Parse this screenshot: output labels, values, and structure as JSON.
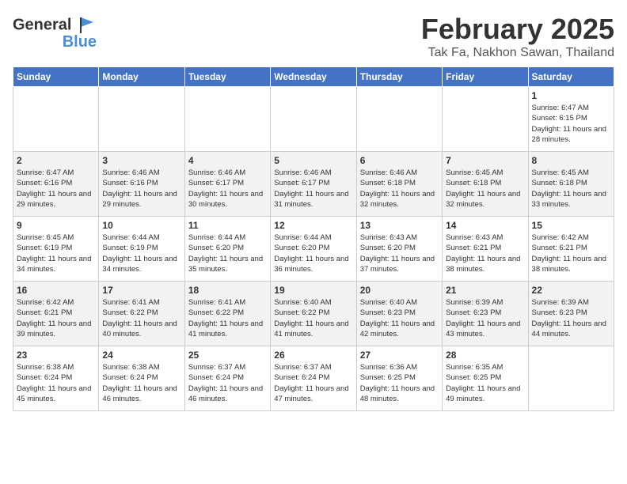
{
  "header": {
    "logo_general": "General",
    "logo_blue": "Blue",
    "month_year": "February 2025",
    "location": "Tak Fa, Nakhon Sawan, Thailand"
  },
  "days_of_week": [
    "Sunday",
    "Monday",
    "Tuesday",
    "Wednesday",
    "Thursday",
    "Friday",
    "Saturday"
  ],
  "weeks": [
    [
      {
        "day": "",
        "sunrise": "",
        "sunset": "",
        "daylight": ""
      },
      {
        "day": "",
        "sunrise": "",
        "sunset": "",
        "daylight": ""
      },
      {
        "day": "",
        "sunrise": "",
        "sunset": "",
        "daylight": ""
      },
      {
        "day": "",
        "sunrise": "",
        "sunset": "",
        "daylight": ""
      },
      {
        "day": "",
        "sunrise": "",
        "sunset": "",
        "daylight": ""
      },
      {
        "day": "",
        "sunrise": "",
        "sunset": "",
        "daylight": ""
      },
      {
        "day": "1",
        "sunrise": "Sunrise: 6:47 AM",
        "sunset": "Sunset: 6:15 PM",
        "daylight": "Daylight: 11 hours and 28 minutes."
      }
    ],
    [
      {
        "day": "2",
        "sunrise": "Sunrise: 6:47 AM",
        "sunset": "Sunset: 6:16 PM",
        "daylight": "Daylight: 11 hours and 29 minutes."
      },
      {
        "day": "3",
        "sunrise": "Sunrise: 6:46 AM",
        "sunset": "Sunset: 6:16 PM",
        "daylight": "Daylight: 11 hours and 29 minutes."
      },
      {
        "day": "4",
        "sunrise": "Sunrise: 6:46 AM",
        "sunset": "Sunset: 6:17 PM",
        "daylight": "Daylight: 11 hours and 30 minutes."
      },
      {
        "day": "5",
        "sunrise": "Sunrise: 6:46 AM",
        "sunset": "Sunset: 6:17 PM",
        "daylight": "Daylight: 11 hours and 31 minutes."
      },
      {
        "day": "6",
        "sunrise": "Sunrise: 6:46 AM",
        "sunset": "Sunset: 6:18 PM",
        "daylight": "Daylight: 11 hours and 32 minutes."
      },
      {
        "day": "7",
        "sunrise": "Sunrise: 6:45 AM",
        "sunset": "Sunset: 6:18 PM",
        "daylight": "Daylight: 11 hours and 32 minutes."
      },
      {
        "day": "8",
        "sunrise": "Sunrise: 6:45 AM",
        "sunset": "Sunset: 6:18 PM",
        "daylight": "Daylight: 11 hours and 33 minutes."
      }
    ],
    [
      {
        "day": "9",
        "sunrise": "Sunrise: 6:45 AM",
        "sunset": "Sunset: 6:19 PM",
        "daylight": "Daylight: 11 hours and 34 minutes."
      },
      {
        "day": "10",
        "sunrise": "Sunrise: 6:44 AM",
        "sunset": "Sunset: 6:19 PM",
        "daylight": "Daylight: 11 hours and 34 minutes."
      },
      {
        "day": "11",
        "sunrise": "Sunrise: 6:44 AM",
        "sunset": "Sunset: 6:20 PM",
        "daylight": "Daylight: 11 hours and 35 minutes."
      },
      {
        "day": "12",
        "sunrise": "Sunrise: 6:44 AM",
        "sunset": "Sunset: 6:20 PM",
        "daylight": "Daylight: 11 hours and 36 minutes."
      },
      {
        "day": "13",
        "sunrise": "Sunrise: 6:43 AM",
        "sunset": "Sunset: 6:20 PM",
        "daylight": "Daylight: 11 hours and 37 minutes."
      },
      {
        "day": "14",
        "sunrise": "Sunrise: 6:43 AM",
        "sunset": "Sunset: 6:21 PM",
        "daylight": "Daylight: 11 hours and 38 minutes."
      },
      {
        "day": "15",
        "sunrise": "Sunrise: 6:42 AM",
        "sunset": "Sunset: 6:21 PM",
        "daylight": "Daylight: 11 hours and 38 minutes."
      }
    ],
    [
      {
        "day": "16",
        "sunrise": "Sunrise: 6:42 AM",
        "sunset": "Sunset: 6:21 PM",
        "daylight": "Daylight: 11 hours and 39 minutes."
      },
      {
        "day": "17",
        "sunrise": "Sunrise: 6:41 AM",
        "sunset": "Sunset: 6:22 PM",
        "daylight": "Daylight: 11 hours and 40 minutes."
      },
      {
        "day": "18",
        "sunrise": "Sunrise: 6:41 AM",
        "sunset": "Sunset: 6:22 PM",
        "daylight": "Daylight: 11 hours and 41 minutes."
      },
      {
        "day": "19",
        "sunrise": "Sunrise: 6:40 AM",
        "sunset": "Sunset: 6:22 PM",
        "daylight": "Daylight: 11 hours and 41 minutes."
      },
      {
        "day": "20",
        "sunrise": "Sunrise: 6:40 AM",
        "sunset": "Sunset: 6:23 PM",
        "daylight": "Daylight: 11 hours and 42 minutes."
      },
      {
        "day": "21",
        "sunrise": "Sunrise: 6:39 AM",
        "sunset": "Sunset: 6:23 PM",
        "daylight": "Daylight: 11 hours and 43 minutes."
      },
      {
        "day": "22",
        "sunrise": "Sunrise: 6:39 AM",
        "sunset": "Sunset: 6:23 PM",
        "daylight": "Daylight: 11 hours and 44 minutes."
      }
    ],
    [
      {
        "day": "23",
        "sunrise": "Sunrise: 6:38 AM",
        "sunset": "Sunset: 6:24 PM",
        "daylight": "Daylight: 11 hours and 45 minutes."
      },
      {
        "day": "24",
        "sunrise": "Sunrise: 6:38 AM",
        "sunset": "Sunset: 6:24 PM",
        "daylight": "Daylight: 11 hours and 46 minutes."
      },
      {
        "day": "25",
        "sunrise": "Sunrise: 6:37 AM",
        "sunset": "Sunset: 6:24 PM",
        "daylight": "Daylight: 11 hours and 46 minutes."
      },
      {
        "day": "26",
        "sunrise": "Sunrise: 6:37 AM",
        "sunset": "Sunset: 6:24 PM",
        "daylight": "Daylight: 11 hours and 47 minutes."
      },
      {
        "day": "27",
        "sunrise": "Sunrise: 6:36 AM",
        "sunset": "Sunset: 6:25 PM",
        "daylight": "Daylight: 11 hours and 48 minutes."
      },
      {
        "day": "28",
        "sunrise": "Sunrise: 6:35 AM",
        "sunset": "Sunset: 6:25 PM",
        "daylight": "Daylight: 11 hours and 49 minutes."
      },
      {
        "day": "",
        "sunrise": "",
        "sunset": "",
        "daylight": ""
      }
    ]
  ]
}
